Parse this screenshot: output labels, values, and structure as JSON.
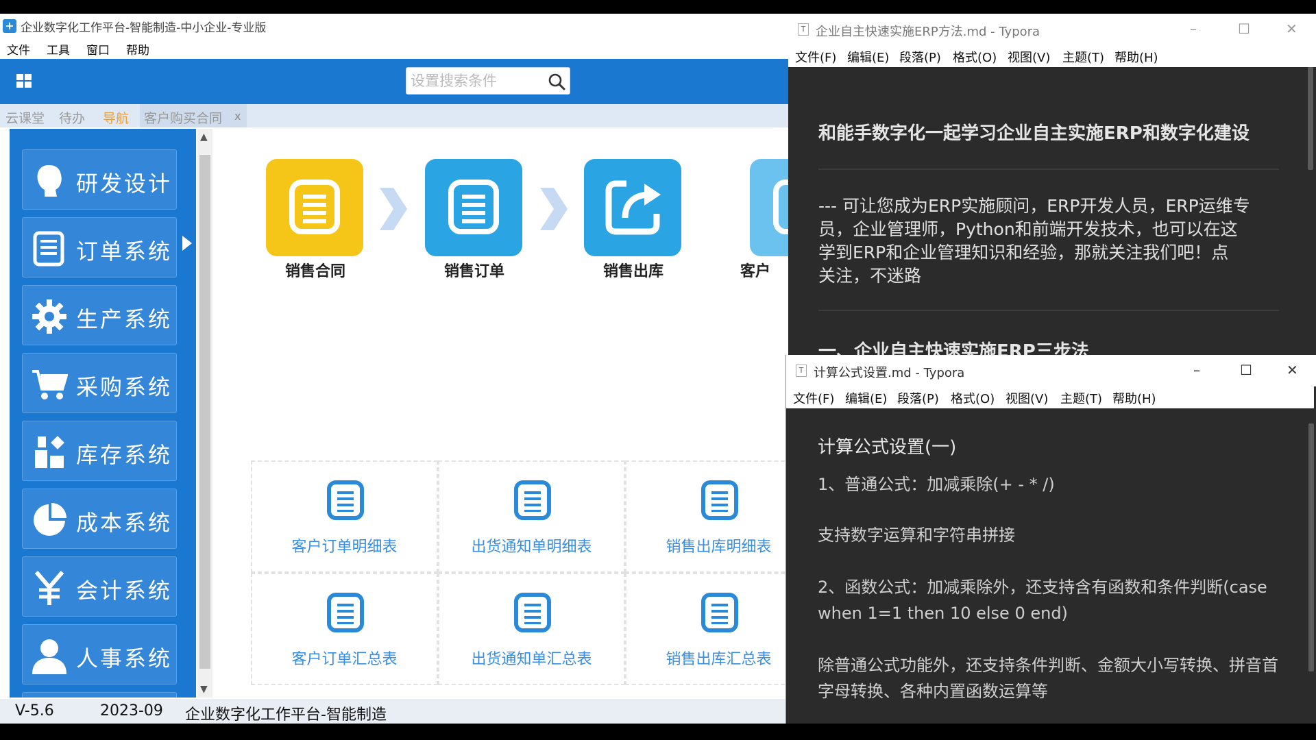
{
  "erp": {
    "window_title": "企业数字化工作平台-智能制造-中小企业-专业版",
    "app_icon_glyph": "+",
    "menu": [
      "文件",
      "工具",
      "窗口",
      "帮助"
    ],
    "search_placeholder": "设置搜索条件",
    "tabs": [
      {
        "label": "云课堂",
        "active": false
      },
      {
        "label": "待办",
        "active": false
      },
      {
        "label": "导航",
        "active": true
      },
      {
        "label": "客户购买合同",
        "active": false,
        "closable": true
      }
    ],
    "tab_close_glyph": "x",
    "sidebar": [
      {
        "label": "研发设计",
        "icon": "person-head-icon"
      },
      {
        "label": "订单系统",
        "icon": "document-list-icon"
      },
      {
        "label": "生产系统",
        "icon": "gear-icon"
      },
      {
        "label": "采购系统",
        "icon": "shopping-cart-icon"
      },
      {
        "label": "库存系统",
        "icon": "blocks-icon"
      },
      {
        "label": "成本系统",
        "icon": "pie-chart-icon"
      },
      {
        "label": "会计系统",
        "icon": "yen-icon"
      },
      {
        "label": "人事系统",
        "icon": "user-icon"
      }
    ],
    "flow": [
      {
        "label": "销售合同",
        "color": "#f5c518"
      },
      {
        "label": "销售订单",
        "color": "#2aa4e2"
      },
      {
        "label": "销售出库",
        "color": "#2aa4e2"
      },
      {
        "label": "客户",
        "color": "#6cc2ee"
      }
    ],
    "reports": [
      "客户订单明细表",
      "出货通知单明细表",
      "销售出库明细表",
      "客户订单汇总表",
      "出货通知单汇总表",
      "销售出库汇总表"
    ],
    "status": {
      "version": "V-5.6",
      "date": "2023-09",
      "platform": "企业数字化工作平台-智能制造"
    },
    "colors": {
      "primary": "#1b78d0",
      "accent": "#f0a030",
      "report_text": "#3a8ee0"
    }
  },
  "typora1": {
    "title": "企业自主快速实施ERP方法.md - Typora",
    "menu": [
      "文件(F)",
      "编辑(E)",
      "段落(P)",
      "格式(O)",
      "视图(V)",
      "主题(T)",
      "帮助(H)"
    ],
    "heading": "和能手数字化一起学习企业自主实施ERP和数字化建设",
    "para_lines": [
      "--- 可让您成为ERP实施顾问，ERP开发人员，ERP运维专",
      "员，企业管理师，Python和前端开发技术，也可以在这",
      "学到ERP和企业管理知识和经验，那就关注我们吧！点",
      "关注，不迷路"
    ],
    "section_heading": "一、企业自主快速实施ERP三步法"
  },
  "typora2": {
    "title": "计算公式设置.md - Typora",
    "menu": [
      "文件(F)",
      "编辑(E)",
      "段落(P)",
      "格式(O)",
      "视图(V)",
      "主题(T)",
      "帮助(H)"
    ],
    "heading": "计算公式设置(一)",
    "p1": "1、普通公式：加减乘除(+ - * /)",
    "p2": "支持数字运算和字符串拼接",
    "p3_l1": "2、函数公式：加减乘除外，还支持含有函数和条件判断(case",
    "p3_l2": "when 1=1 then 10 else 0 end)",
    "p4_l1": "除普通公式功能外，还支持条件判断、金额大小写转换、拼音首",
    "p4_l2": "字母转换、各种内置函数运算等"
  },
  "window_controls": {
    "minimize": "–",
    "maximize": "☐",
    "close": "✕"
  }
}
